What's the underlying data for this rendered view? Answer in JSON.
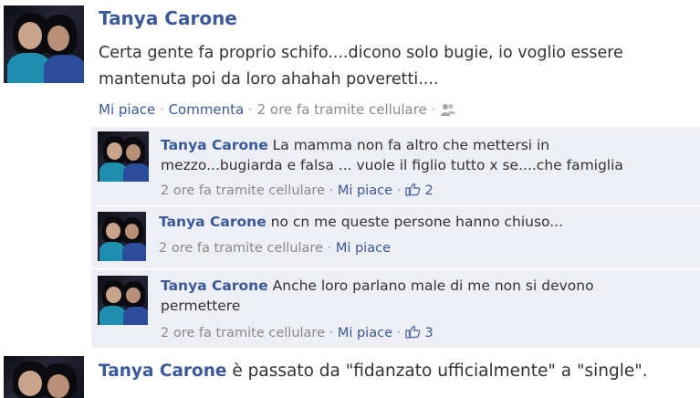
{
  "post": {
    "author": "Tanya Carone",
    "text": "Certa gente fa proprio schifo....dicono solo bugie, io voglio essere mantenuta poi da loro ahahah poveretti....",
    "like_label": "Mi piace",
    "comment_label": "Commenta",
    "timestamp": "2 ore fa tramite cellulare",
    "audience_icon": "friends-icon"
  },
  "comments": [
    {
      "author": "Tanya Carone",
      "text_line1": "La mamma non fa altro che mettersi in",
      "text_line2": "mezzo...bugiarda e falsa ... vuole il figlio tutto x se....che famiglia",
      "timestamp": "2 ore fa tramite cellulare",
      "like_label": "Mi piace",
      "like_count": "2"
    },
    {
      "author": "Tanya Carone",
      "text_line1": "no cn me queste persone hanno chiuso...",
      "timestamp": "2 ore fa tramite cellulare",
      "like_label": "Mi piace"
    },
    {
      "author": "Tanya Carone",
      "text_line1": "Anche loro parlano male di me non si devono",
      "text_line2": "permettere",
      "timestamp": "2 ore fa tramite cellulare",
      "like_label": "Mi piace",
      "like_count": "3"
    }
  ],
  "status_update": {
    "author": "Tanya Carone",
    "text": "è passato da \"fidanzato ufficialmente\" a \"single\"."
  },
  "colors": {
    "link": "#3b5998",
    "meta": "#8a8a8a",
    "comment_bg": "#edeff4"
  }
}
